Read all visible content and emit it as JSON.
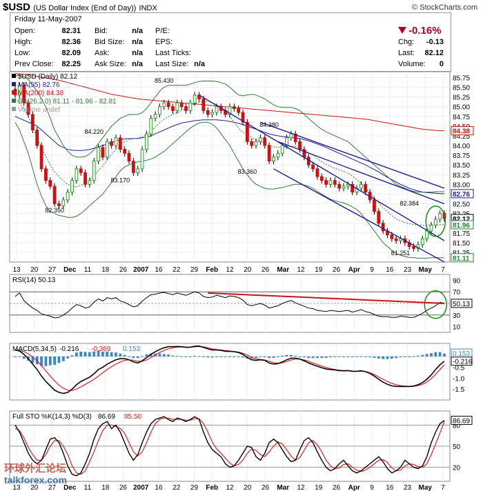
{
  "header": {
    "symbol": "$USD",
    "description": "(US Dollar Index (End of Day))",
    "exchange": "INDX",
    "credit": "© StockCharts.com"
  },
  "quote": {
    "date": "Friday  11-May-2007",
    "open_label": "Open:",
    "open": "82.31",
    "high_label": "High:",
    "high": "82.36",
    "low_label": "Low:",
    "low": "82.09",
    "prev_label": "Prev Close:",
    "prev": "82.25",
    "bid_label": "Bid:",
    "bid": "n/a",
    "bidsize_label": "Bid Size:",
    "bidsize": "n/a",
    "ask_label": "Ask:",
    "ask": "n/a",
    "asksize_label": "Ask Size:",
    "asksize": "n/a",
    "pe_label": "P/E:",
    "eps_label": "EPS:",
    "lastticks_label": "Last Ticks:",
    "lastsize_label": "Last Size:",
    "lastsize": "n/a",
    "pct_change": "-0.16%",
    "chg_label": "Chg:",
    "chg": "-0.13",
    "last_label": "Last:",
    "last": "82.12",
    "volume_label": "Volume:",
    "volume": "0"
  },
  "colors": {
    "up_candle": "#2a9d2a",
    "down_candle": "#d01010",
    "ma55": "#1c1c9c",
    "ma200": "#d01010",
    "bollinger": "#2e7d32",
    "macd_hist": "#3a87c8",
    "sto_d": "#e02020",
    "circle": "#1a8a1a"
  },
  "chart_data": [
    {
      "type": "candlestick",
      "title": "$USD (Daily) 82.12",
      "legend": [
        {
          "name": "$USD (Daily) 82.12",
          "color": "#000000"
        },
        {
          "name": "MA(55) 82.76",
          "color": "#1c1c9c"
        },
        {
          "name": "MA(200) 84.38",
          "color": "#d01010"
        },
        {
          "name": "BB(26,2.0) 81.11 - 81.96 - 82.81",
          "color": "#2e7d32"
        },
        {
          "name": "Volume undef",
          "color": "#999999"
        }
      ],
      "ylim": [
        81.0,
        85.9
      ],
      "y_ticks": [
        "85.75",
        "85.50",
        "85.25",
        "85.00",
        "84.75",
        "84.50",
        "84.25",
        "84.00",
        "83.75",
        "83.50",
        "83.25",
        "83.00",
        "82.75",
        "82.50",
        "82.25",
        "82.00",
        "81.75",
        "81.50",
        "81.25"
      ],
      "x_ticks": [
        "13",
        "20",
        "27",
        "Dec",
        "11",
        "18",
        "26",
        "2007",
        "16",
        "22",
        "29",
        "Feb",
        "12",
        "20",
        "26",
        "Mar",
        "12",
        "19",
        "26",
        "Apr",
        "9",
        "16",
        "23",
        "May",
        "7"
      ],
      "annotations": [
        "85.430",
        "84.220",
        "84.380",
        "83.170",
        "83.360",
        "82.350",
        "82.384",
        "81.251"
      ],
      "right_labels": [
        {
          "text": "84.38",
          "value": 84.38,
          "color": "#d01010"
        },
        {
          "text": "82.76",
          "value": 82.76,
          "color": "#1c1c9c"
        },
        {
          "text": "82.12",
          "value": 82.12,
          "color": "#000000"
        },
        {
          "text": "81.96",
          "value": 81.96,
          "color": "#2e7d32"
        },
        {
          "text": "81.11",
          "value": 81.11,
          "color": "#2e7d32"
        }
      ],
      "close": [
        85.3,
        85.55,
        85.1,
        84.8,
        84.4,
        84.0,
        83.4,
        83.1,
        82.95,
        82.5,
        82.45,
        82.6,
        82.8,
        83.1,
        83.4,
        83.3,
        83.0,
        83.1,
        83.6,
        83.95,
        83.7,
        84.1,
        84.0,
        84.2,
        83.9,
        83.8,
        83.6,
        83.3,
        83.4,
        83.9,
        84.3,
        84.7,
        84.8,
        85.0,
        85.1,
        85.0,
        84.9,
        85.1,
        85.0,
        84.9,
        85.1,
        85.3,
        85.2,
        84.9,
        84.8,
        84.85,
        85.0,
        84.9,
        84.8,
        85.0,
        84.95,
        84.85,
        84.6,
        84.1,
        84.0,
        84.1,
        84.2,
        84.0,
        83.6,
        83.7,
        83.8,
        84.0,
        84.2,
        84.3,
        84.1,
        83.9,
        83.7,
        83.5,
        83.4,
        83.2,
        83.1,
        83.0,
        83.1,
        83.0,
        82.9,
        82.95,
        83.0,
        82.8,
        82.9,
        83.0,
        82.8,
        82.6,
        82.3,
        82.0,
        81.8,
        81.7,
        81.6,
        81.55,
        81.6,
        81.5,
        81.4,
        81.35,
        81.45,
        81.6,
        81.8,
        81.95,
        82.1,
        82.25,
        82.12
      ],
      "ma55": [
        84.75,
        84.7,
        84.65,
        84.6,
        84.55,
        84.5,
        84.4,
        84.3,
        84.2,
        84.1,
        84.0,
        83.95,
        83.9,
        83.88,
        83.87,
        83.87,
        83.88,
        83.9,
        83.93,
        83.96,
        84.0,
        84.04,
        84.08,
        84.12,
        84.15,
        84.17,
        84.18,
        84.18,
        84.18,
        84.2,
        84.22,
        84.25,
        84.3,
        84.35,
        84.4,
        84.45,
        84.5,
        84.54,
        84.58,
        84.6,
        84.62,
        84.64,
        84.65,
        84.66,
        84.66,
        84.66,
        84.66,
        84.65,
        84.64,
        84.62,
        84.6,
        84.57,
        84.54,
        84.5,
        84.46,
        84.42,
        84.38,
        84.34,
        84.3,
        84.27,
        84.25,
        84.23,
        84.22,
        84.21,
        84.2,
        84.18,
        84.15,
        84.12,
        84.08,
        84.04,
        84.0,
        83.95,
        83.9,
        83.85,
        83.8,
        83.75,
        83.7,
        83.65,
        83.6,
        83.55,
        83.5,
        83.44,
        83.38,
        83.32,
        83.25,
        83.18,
        83.12,
        83.06,
        83.0,
        82.95,
        82.9,
        82.86,
        82.83,
        82.8,
        82.79,
        82.78,
        82.77,
        82.76,
        82.76
      ],
      "ma200": [
        85.85,
        85.84,
        85.83,
        85.82,
        85.8,
        85.78,
        85.76,
        85.74,
        85.72,
        85.7,
        85.68,
        85.65,
        85.62,
        85.59,
        85.56,
        85.53,
        85.5,
        85.47,
        85.44,
        85.41,
        85.38,
        85.35,
        85.32,
        85.3,
        85.28,
        85.26,
        85.24,
        85.22,
        85.2,
        85.19,
        85.18,
        85.17,
        85.16,
        85.15,
        85.14,
        85.13,
        85.12,
        85.11,
        85.1,
        85.09,
        85.08,
        85.07,
        85.06,
        85.05,
        85.04,
        85.03,
        85.02,
        85.01,
        85.0,
        84.99,
        84.98,
        84.97,
        84.96,
        84.95,
        84.94,
        84.93,
        84.92,
        84.91,
        84.9,
        84.89,
        84.88,
        84.87,
        84.86,
        84.85,
        84.84,
        84.83,
        84.82,
        84.81,
        84.8,
        84.79,
        84.78,
        84.77,
        84.76,
        84.75,
        84.74,
        84.73,
        84.72,
        84.71,
        84.7,
        84.69,
        84.68,
        84.66,
        84.64,
        84.62,
        84.6,
        84.58,
        84.56,
        84.54,
        84.52,
        84.5,
        84.48,
        84.46,
        84.44,
        84.42,
        84.41,
        84.4,
        84.39,
        84.38,
        84.38
      ],
      "bb_upper": [
        85.8,
        85.8,
        85.78,
        85.7,
        85.55,
        85.4,
        85.2,
        85.0,
        84.7,
        84.4,
        84.2,
        84.0,
        83.85,
        83.75,
        83.7,
        83.7,
        83.72,
        83.78,
        83.9,
        84.05,
        84.2,
        84.35,
        84.5,
        84.6,
        84.7,
        84.75,
        84.8,
        84.8,
        84.8,
        84.85,
        84.95,
        85.1,
        85.25,
        85.4,
        85.5,
        85.55,
        85.55,
        85.55,
        85.55,
        85.55,
        85.58,
        85.62,
        85.65,
        85.66,
        85.66,
        85.66,
        85.65,
        85.62,
        85.58,
        85.5,
        85.4,
        85.3,
        85.28,
        85.3,
        85.32,
        85.3,
        85.25,
        85.2,
        85.12,
        85.05,
        85.0,
        84.98,
        84.98,
        84.98,
        84.95,
        84.9,
        84.8,
        84.7,
        84.6,
        84.5,
        84.42,
        84.35,
        84.3,
        84.25,
        84.2,
        84.15,
        84.1,
        84.0,
        83.9,
        83.8,
        83.7,
        83.6,
        83.5,
        83.4,
        83.3,
        83.2,
        83.1,
        83.0,
        82.95,
        82.9,
        82.85,
        82.82,
        82.8,
        82.8,
        82.8,
        82.8,
        82.81,
        82.81,
        82.81
      ],
      "bb_lower": [
        84.6,
        84.4,
        84.1,
        83.8,
        83.4,
        83.0,
        82.7,
        82.45,
        82.3,
        82.25,
        82.2,
        82.18,
        82.15,
        82.15,
        82.18,
        82.25,
        82.35,
        82.45,
        82.55,
        82.65,
        82.75,
        82.9,
        83.05,
        83.2,
        83.35,
        83.45,
        83.5,
        83.55,
        83.58,
        83.6,
        83.62,
        83.65,
        83.7,
        83.78,
        83.85,
        83.95,
        84.05,
        84.15,
        84.25,
        84.35,
        84.45,
        84.52,
        84.58,
        84.6,
        84.6,
        84.55,
        84.45,
        84.3,
        84.15,
        84.0,
        83.8,
        83.6,
        83.4,
        83.25,
        83.1,
        83.0,
        82.95,
        82.9,
        82.88,
        82.88,
        82.9,
        82.92,
        82.95,
        82.98,
        83.0,
        83.0,
        82.98,
        82.95,
        82.9,
        82.82,
        82.75,
        82.68,
        82.62,
        82.58,
        82.55,
        82.52,
        82.48,
        82.42,
        82.35,
        82.25,
        82.1,
        81.95,
        81.8,
        81.65,
        81.5,
        81.4,
        81.3,
        81.22,
        81.18,
        81.14,
        81.12,
        81.11,
        81.1,
        81.1,
        81.1,
        81.11,
        81.11,
        81.11,
        81.11
      ]
    },
    {
      "type": "line",
      "title": "RSI(14) 50.13",
      "ylim": [
        0,
        100
      ],
      "y_ticks": [
        "90",
        "70",
        "50",
        "30",
        "10"
      ],
      "values": [
        62,
        68,
        55,
        48,
        42,
        38,
        32,
        30,
        28,
        25,
        26,
        30,
        35,
        42,
        48,
        46,
        42,
        44,
        52,
        58,
        54,
        60,
        58,
        60,
        54,
        52,
        48,
        44,
        46,
        54,
        60,
        65,
        66,
        68,
        69,
        67,
        65,
        68,
        66,
        64,
        67,
        70,
        68,
        62,
        60,
        61,
        64,
        62,
        60,
        63,
        62,
        60,
        56,
        48,
        46,
        48,
        50,
        47,
        42,
        44,
        46,
        50,
        53,
        55,
        51,
        48,
        45,
        42,
        41,
        38,
        37,
        36,
        38,
        37,
        36,
        37,
        38,
        35,
        37,
        39,
        36,
        34,
        31,
        28,
        27,
        27,
        26,
        26,
        28,
        27,
        26,
        26,
        29,
        33,
        38,
        42,
        46,
        52,
        50
      ],
      "lines": [
        70,
        50,
        30
      ],
      "right_label": "50.13"
    },
    {
      "type": "line",
      "title": "MACD(5,34,5) -0.216, -0.369, 0.153",
      "series": [
        {
          "name": "MACD(5,34,5)",
          "value": "-0.216",
          "color": "#000000"
        },
        {
          "name": "Signal",
          "value": "-0.369",
          "color": "#e02020"
        },
        {
          "name": "Histogram",
          "value": "0.153",
          "color": "#3a87c8"
        }
      ],
      "ylim": [
        -2.0,
        0.6
      ],
      "y_ticks": [
        "0.153",
        "-0.216",
        "0.0",
        "-0.5",
        "-1.0",
        "-1.5"
      ],
      "macd": [
        0.3,
        0.25,
        0.1,
        -0.1,
        -0.35,
        -0.6,
        -0.9,
        -1.15,
        -1.35,
        -1.55,
        -1.65,
        -1.7,
        -1.65,
        -1.5,
        -1.3,
        -1.15,
        -1.05,
        -0.95,
        -0.8,
        -0.6,
        -0.5,
        -0.35,
        -0.25,
        -0.15,
        -0.1,
        -0.1,
        -0.15,
        -0.25,
        -0.3,
        -0.2,
        -0.05,
        0.1,
        0.22,
        0.32,
        0.4,
        0.45,
        0.45,
        0.46,
        0.45,
        0.42,
        0.43,
        0.47,
        0.48,
        0.42,
        0.35,
        0.3,
        0.3,
        0.28,
        0.24,
        0.24,
        0.22,
        0.18,
        0.1,
        -0.05,
        -0.15,
        -0.18,
        -0.15,
        -0.18,
        -0.3,
        -0.35,
        -0.33,
        -0.25,
        -0.15,
        -0.08,
        -0.08,
        -0.12,
        -0.2,
        -0.3,
        -0.38,
        -0.45,
        -0.52,
        -0.58,
        -0.6,
        -0.62,
        -0.65,
        -0.66,
        -0.65,
        -0.68,
        -0.68,
        -0.66,
        -0.7,
        -0.78,
        -0.9,
        -1.05,
        -1.18,
        -1.28,
        -1.35,
        -1.38,
        -1.38,
        -1.38,
        -1.38,
        -1.36,
        -1.3,
        -1.2,
        -1.05,
        -0.85,
        -0.6,
        -0.38,
        -0.22
      ],
      "signal": [
        0.3,
        0.28,
        0.22,
        0.12,
        -0.02,
        -0.2,
        -0.42,
        -0.66,
        -0.9,
        -1.12,
        -1.32,
        -1.46,
        -1.55,
        -1.56,
        -1.5,
        -1.4,
        -1.28,
        -1.17,
        -1.05,
        -0.9,
        -0.75,
        -0.6,
        -0.47,
        -0.35,
        -0.25,
        -0.18,
        -0.15,
        -0.17,
        -0.22,
        -0.22,
        -0.16,
        -0.05,
        0.07,
        0.18,
        0.28,
        0.35,
        0.4,
        0.43,
        0.44,
        0.43,
        0.43,
        0.44,
        0.46,
        0.44,
        0.4,
        0.35,
        0.32,
        0.3,
        0.27,
        0.25,
        0.23,
        0.2,
        0.15,
        0.06,
        -0.04,
        -0.11,
        -0.14,
        -0.16,
        -0.22,
        -0.28,
        -0.31,
        -0.29,
        -0.23,
        -0.16,
        -0.12,
        -0.12,
        -0.16,
        -0.22,
        -0.3,
        -0.37,
        -0.44,
        -0.51,
        -0.56,
        -0.6,
        -0.63,
        -0.65,
        -0.65,
        -0.67,
        -0.68,
        -0.67,
        -0.69,
        -0.75,
        -0.83,
        -0.94,
        -1.05,
        -1.15,
        -1.24,
        -1.3,
        -1.34,
        -1.36,
        -1.37,
        -1.37,
        -1.34,
        -1.28,
        -1.18,
        -1.02,
        -0.82,
        -0.6,
        -0.37
      ]
    },
    {
      "type": "line",
      "title": "Full STO %K(14,3) %D(3) 86.69, 85.50",
      "series": [
        {
          "name": "%K(14,3)",
          "value": "86.69",
          "color": "#000000"
        },
        {
          "name": "%D(3)",
          "value": "85.50",
          "color": "#e02020"
        }
      ],
      "ylim": [
        0,
        100
      ],
      "y_ticks": [
        "80",
        "50",
        "20"
      ],
      "lines": [
        80,
        50,
        20
      ],
      "k": [
        80,
        70,
        55,
        40,
        30,
        25,
        30,
        45,
        60,
        62,
        55,
        40,
        22,
        10,
        8,
        12,
        25,
        40,
        60,
        75,
        82,
        85,
        75,
        80,
        70,
        55,
        40,
        30,
        38,
        55,
        70,
        82,
        88,
        90,
        92,
        88,
        85,
        90,
        88,
        85,
        88,
        92,
        88,
        70,
        55,
        45,
        40,
        35,
        25,
        20,
        22,
        30,
        40,
        50,
        48,
        35,
        30,
        40,
        55,
        60,
        55,
        45,
        35,
        28,
        30,
        45,
        58,
        62,
        55,
        42,
        30,
        20,
        15,
        18,
        25,
        30,
        22,
        15,
        12,
        15,
        20,
        25,
        30,
        35,
        28,
        18,
        12,
        15,
        20,
        30,
        25,
        20,
        18,
        22,
        35,
        55,
        70,
        82,
        86.69
      ],
      "d": [
        75,
        72,
        62,
        48,
        38,
        30,
        30,
        38,
        50,
        58,
        58,
        50,
        38,
        22,
        12,
        10,
        15,
        28,
        42,
        58,
        72,
        80,
        80,
        78,
        75,
        68,
        55,
        42,
        36,
        42,
        55,
        70,
        82,
        88,
        90,
        90,
        88,
        88,
        88,
        87,
        87,
        89,
        89,
        82,
        70,
        56,
        46,
        40,
        33,
        26,
        22,
        24,
        30,
        40,
        46,
        44,
        38,
        35,
        42,
        50,
        56,
        53,
        45,
        36,
        30,
        34,
        44,
        55,
        58,
        52,
        42,
        30,
        22,
        18,
        19,
        24,
        25,
        20,
        16,
        14,
        16,
        20,
        25,
        30,
        31,
        27,
        19,
        15,
        16,
        22,
        25,
        24,
        21,
        20,
        25,
        38,
        53,
        69,
        85.5
      ]
    }
  ],
  "watermark": {
    "chinese": "环球外汇论坛",
    "site": "talkforex.com"
  }
}
